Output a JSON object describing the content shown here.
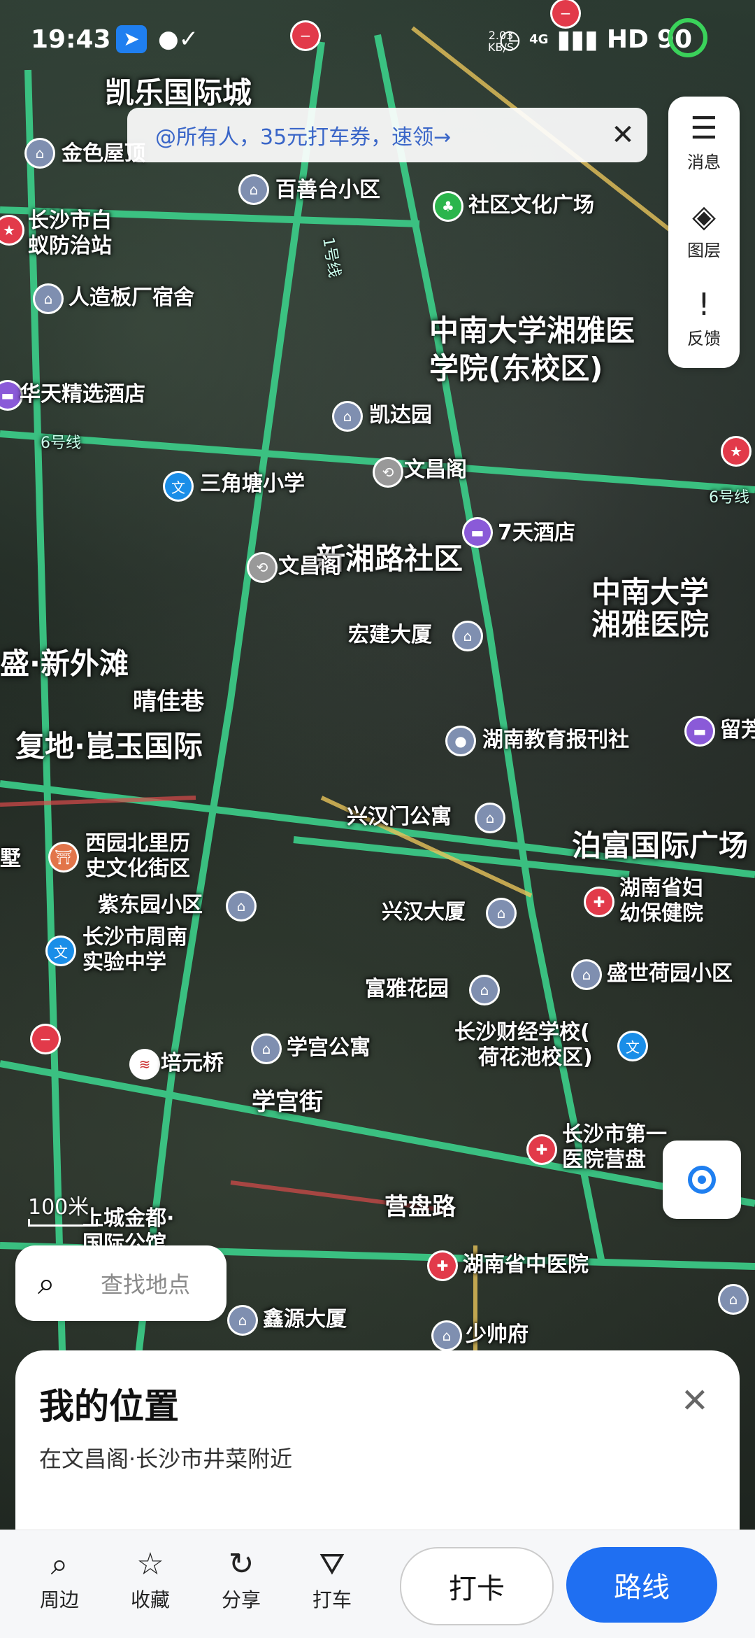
{
  "status_bar": {
    "time": "19:43",
    "net_speed": "2.03\nKB/S",
    "network": "4G",
    "hd": "HD",
    "battery": "90"
  },
  "banner": {
    "text": "@所有人，35元打车券，速领→",
    "close_icon": "close-icon"
  },
  "side_panel": [
    {
      "label": "消息",
      "icon": "message-icon"
    },
    {
      "label": "图层",
      "icon": "layers-icon"
    },
    {
      "label": "反馈",
      "icon": "feedback-icon"
    }
  ],
  "map": {
    "districts": [
      "凯乐国际城",
      "中南大学湘雅医",
      "学院(东校区)",
      "新湘路社区",
      "中南大学",
      "湘雅医院",
      "盛·新外滩",
      "复地·崑玉国际",
      "泊富国际广场",
      "晴佳巷",
      "学宫街",
      "营盘路"
    ],
    "pois": [
      "金色屋顶",
      "百善台小区",
      "社区文化广场",
      "长沙市白",
      "蚁防治站",
      "人造板厂宿舍",
      "华天精选酒店",
      "凯达园",
      "文昌阁",
      "三角塘小学",
      "7天酒店",
      "文昌阁",
      "宏建大厦",
      "湖南教育报刊社",
      "留芳",
      "兴汉门公寓",
      "西园北里历",
      "史文化街区",
      "紫东园小区",
      "兴汉大厦",
      "湖南省妇",
      "幼保健院",
      "长沙市周南",
      "实验中学",
      "富雅花园",
      "盛世荷园小区",
      "长沙财经学校(",
      "荷花池校区)",
      "培元桥",
      "学宫公寓",
      "长沙市第一",
      "医院营盘",
      "上城金都·",
      "国际公馆",
      "湖南省中医院",
      "鑫源大厦",
      "少帅府",
      "6号线",
      "6号线",
      "1号线",
      "墅"
    ],
    "scale_label": "100米"
  },
  "search": {
    "placeholder": "查找地点"
  },
  "sheet": {
    "title": "我的位置",
    "subtitle": "在文昌阁·长沙市井菜附近"
  },
  "toolbar": {
    "nearby": "周边",
    "favorite": "收藏",
    "share": "分享",
    "taxi": "打车",
    "checkin": "打卡",
    "route": "路线"
  }
}
